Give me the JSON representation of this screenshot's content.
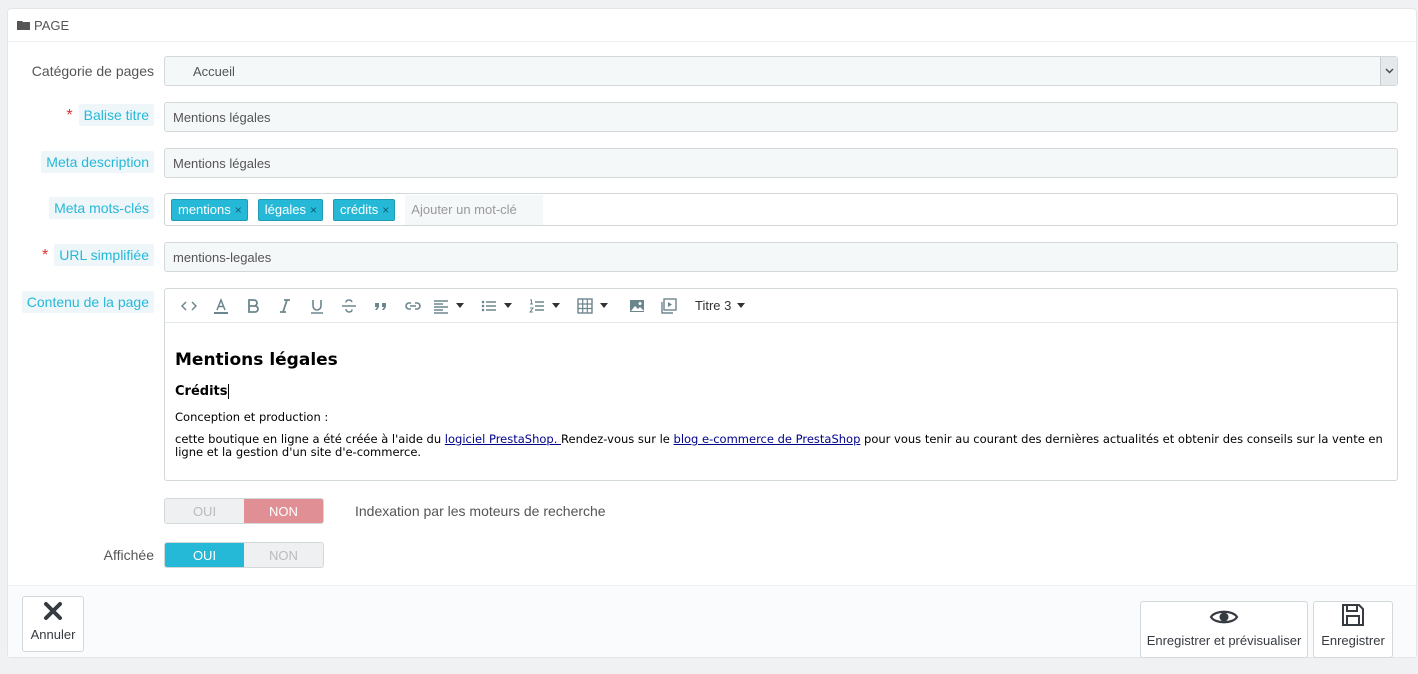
{
  "panel": {
    "heading": "PAGE",
    "heading_icon": "folder-icon"
  },
  "form": {
    "category": {
      "label": "Catégorie de pages",
      "value": "Accueil"
    },
    "title": {
      "required_mark": "*",
      "label": "Balise titre",
      "value": "Mentions légales"
    },
    "meta_description": {
      "label": "Meta description",
      "value": "Mentions légales"
    },
    "meta_keywords": {
      "label": "Meta mots-clés",
      "tags": [
        {
          "text": "mentions",
          "remove": "×"
        },
        {
          "text": "légales",
          "remove": "×"
        },
        {
          "text": "crédits",
          "remove": "×"
        }
      ],
      "placeholder": "Ajouter un mot-clé"
    },
    "url": {
      "required_mark": "*",
      "label": "URL simplifiée",
      "value": "mentions-legales"
    },
    "content": {
      "label": "Contenu de la page",
      "toolbar": {
        "heading_select": "Titre 3"
      },
      "body": {
        "h1": "Mentions légales",
        "h2": "Crédits",
        "p1": "Conception et production :",
        "p2_pre": "cette boutique en ligne a été créée à l'aide du ",
        "p2_link1": "logiciel PrestaShop. ",
        "p2_mid": "Rendez-vous sur le ",
        "p2_link2": "blog e-commerce de PrestaShop",
        "p2_post": " pour vous tenir au courant des dernières actualités et obtenir des conseils sur la vente en ligne et la gestion d'un site d'e-commerce."
      }
    },
    "indexation": {
      "oui": "OUI",
      "non": "NON",
      "selected": "NON",
      "description": "Indexation par les moteurs de recherche"
    },
    "displayed": {
      "label": "Affichée",
      "oui": "OUI",
      "non": "NON",
      "selected": "OUI"
    }
  },
  "footer": {
    "cancel": "Annuler",
    "save_preview": "Enregistrer et prévisualiser",
    "save": "Enregistrer"
  },
  "colors": {
    "accent": "#25b9d7",
    "danger": "#e08f95",
    "required": "#e02f2f"
  }
}
